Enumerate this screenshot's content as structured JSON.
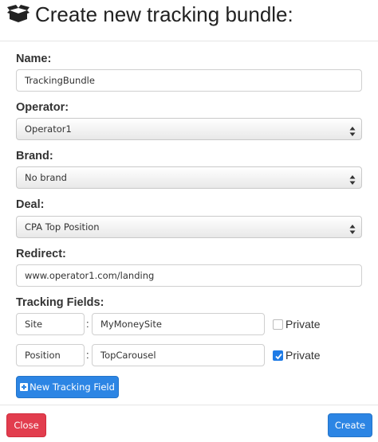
{
  "header": {
    "title": "Create new tracking bundle:",
    "icon": "box-icon"
  },
  "form": {
    "name": {
      "label": "Name:",
      "value": "TrackingBundle"
    },
    "operator": {
      "label": "Operator:",
      "selected": "Operator1"
    },
    "brand": {
      "label": "Brand:",
      "selected": "No brand"
    },
    "deal": {
      "label": "Deal:",
      "selected": "CPA Top Position"
    },
    "redirect": {
      "label": "Redirect:",
      "value": "www.operator1.com/landing"
    },
    "tracking_fields": {
      "label": "Tracking Fields:",
      "separator": ":",
      "private_label": "Private",
      "rows": [
        {
          "key": "Site",
          "value": "MyMoneySite",
          "private": false
        },
        {
          "key": "Position",
          "value": "TopCarousel",
          "private": true
        }
      ]
    },
    "new_field_button": "New Tracking Field"
  },
  "footer": {
    "close_label": "Close",
    "create_label": "Create"
  },
  "colors": {
    "primary": "#2c85e4",
    "danger": "#e23d4e"
  }
}
